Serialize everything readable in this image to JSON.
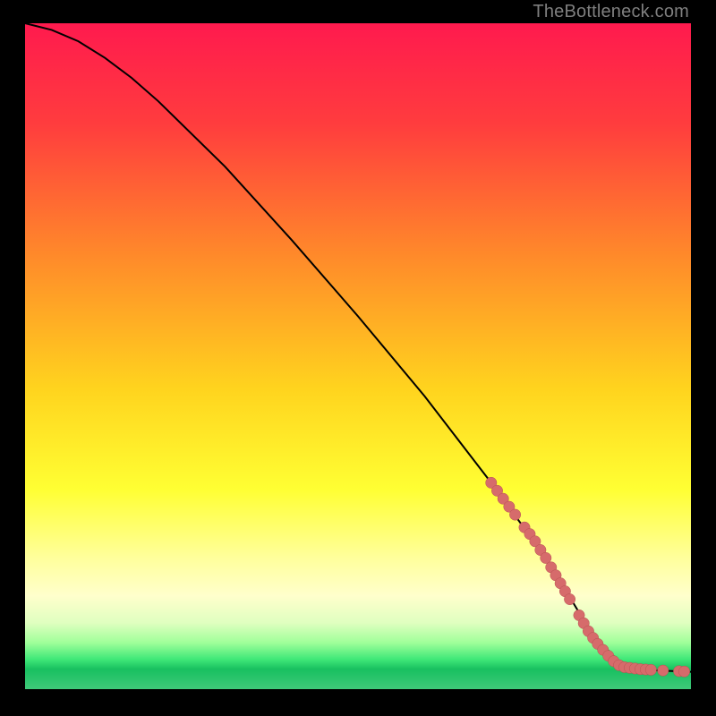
{
  "watermark": "TheBottleneck.com",
  "chart_data": {
    "type": "line",
    "title": "",
    "xlabel": "",
    "ylabel": "",
    "xlim": [
      0,
      100
    ],
    "ylim": [
      0,
      100
    ],
    "gradient_stops": [
      {
        "offset": 0,
        "color": "#ff1a4e"
      },
      {
        "offset": 15,
        "color": "#ff3c3e"
      },
      {
        "offset": 35,
        "color": "#ff8a2a"
      },
      {
        "offset": 55,
        "color": "#ffd41e"
      },
      {
        "offset": 70,
        "color": "#ffff33"
      },
      {
        "offset": 80,
        "color": "#ffff99"
      },
      {
        "offset": 86,
        "color": "#ffffcc"
      },
      {
        "offset": 90,
        "color": "#e0ffc0"
      },
      {
        "offset": 93,
        "color": "#a0ff9a"
      },
      {
        "offset": 95.5,
        "color": "#40e878"
      },
      {
        "offset": 97,
        "color": "#18c060"
      },
      {
        "offset": 100,
        "color": "#3fc979"
      }
    ],
    "series": [
      {
        "name": "bottleneck-curve",
        "x": [
          0,
          4,
          8,
          12,
          16,
          20,
          30,
          40,
          50,
          60,
          70,
          78,
          82,
          85,
          90,
          95,
          100
        ],
        "y": [
          100,
          99,
          97.3,
          94.8,
          91.8,
          88.3,
          78.5,
          67.5,
          56,
          44,
          31,
          20,
          13.5,
          8.5,
          3.3,
          2.8,
          2.6
        ]
      }
    ],
    "scatter": {
      "name": "highlighted-points",
      "points": [
        {
          "x": 70.0,
          "y": 31.0
        },
        {
          "x": 70.9,
          "y": 29.8
        },
        {
          "x": 71.8,
          "y": 28.6
        },
        {
          "x": 72.7,
          "y": 27.4
        },
        {
          "x": 73.6,
          "y": 26.2
        },
        {
          "x": 75.0,
          "y": 24.3
        },
        {
          "x": 75.8,
          "y": 23.3
        },
        {
          "x": 76.6,
          "y": 22.2
        },
        {
          "x": 77.4,
          "y": 20.9
        },
        {
          "x": 78.2,
          "y": 19.7
        },
        {
          "x": 79.0,
          "y": 18.3
        },
        {
          "x": 79.7,
          "y": 17.1
        },
        {
          "x": 80.4,
          "y": 15.9
        },
        {
          "x": 81.1,
          "y": 14.7
        },
        {
          "x": 81.8,
          "y": 13.5
        },
        {
          "x": 83.2,
          "y": 11.1
        },
        {
          "x": 83.9,
          "y": 9.9
        },
        {
          "x": 84.6,
          "y": 8.7
        },
        {
          "x": 85.3,
          "y": 7.7
        },
        {
          "x": 86.0,
          "y": 6.8
        },
        {
          "x": 86.8,
          "y": 5.9
        },
        {
          "x": 87.6,
          "y": 5.0
        },
        {
          "x": 88.4,
          "y": 4.2
        },
        {
          "x": 89.2,
          "y": 3.6
        },
        {
          "x": 90.0,
          "y": 3.3
        },
        {
          "x": 90.8,
          "y": 3.2
        },
        {
          "x": 91.6,
          "y": 3.1
        },
        {
          "x": 92.4,
          "y": 3.0
        },
        {
          "x": 93.2,
          "y": 2.95
        },
        {
          "x": 94.0,
          "y": 2.9
        },
        {
          "x": 95.8,
          "y": 2.8
        },
        {
          "x": 98.2,
          "y": 2.7
        },
        {
          "x": 99.0,
          "y": 2.65
        }
      ]
    }
  }
}
